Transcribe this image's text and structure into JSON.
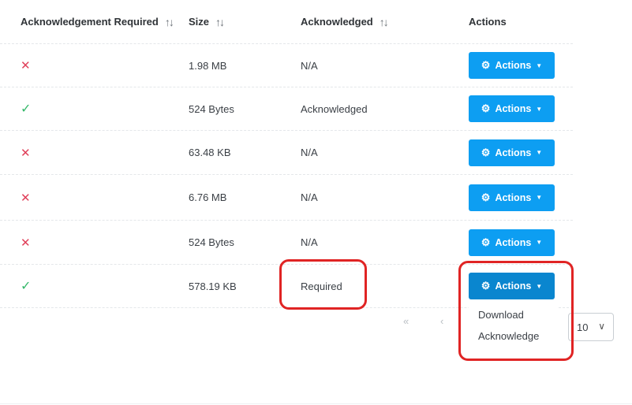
{
  "columns": [
    {
      "label": "Acknowledgement Required",
      "sort_icon": "↑↓"
    },
    {
      "label": "Size",
      "sort_icon": "↑↓"
    },
    {
      "label": "Acknowledged",
      "sort_icon": "↑↓"
    },
    {
      "label": "Actions"
    }
  ],
  "rows": [
    {
      "ack_required": false,
      "ack_icon": "✕",
      "size": "1.98 MB",
      "acknowledged": "N/A",
      "action_label": "Actions"
    },
    {
      "ack_required": true,
      "ack_icon": "✓",
      "size": "524 Bytes",
      "acknowledged": "Acknowledged",
      "action_label": "Actions"
    },
    {
      "ack_required": false,
      "ack_icon": "✕",
      "size": "63.48 KB",
      "acknowledged": "N/A",
      "action_label": "Actions"
    },
    {
      "ack_required": false,
      "ack_icon": "✕",
      "size": "6.76 MB",
      "acknowledged": "N/A",
      "action_label": "Actions"
    },
    {
      "ack_required": false,
      "ack_icon": "✕",
      "size": "524 Bytes",
      "acknowledged": "N/A",
      "action_label": "Actions"
    },
    {
      "ack_required": true,
      "ack_icon": "✓",
      "size": "578.19 KB",
      "acknowledged": "Required",
      "action_label": "Actions"
    }
  ],
  "dropdown": {
    "items": [
      "Download",
      "Acknowledge"
    ]
  },
  "pagination": {
    "first_icon": "«",
    "prev_icon": "‹",
    "page_size": "10"
  },
  "colors": {
    "primary_button": "#0d9ef2",
    "error": "#e0405a",
    "success": "#35b86a",
    "highlight": "#e02424"
  }
}
